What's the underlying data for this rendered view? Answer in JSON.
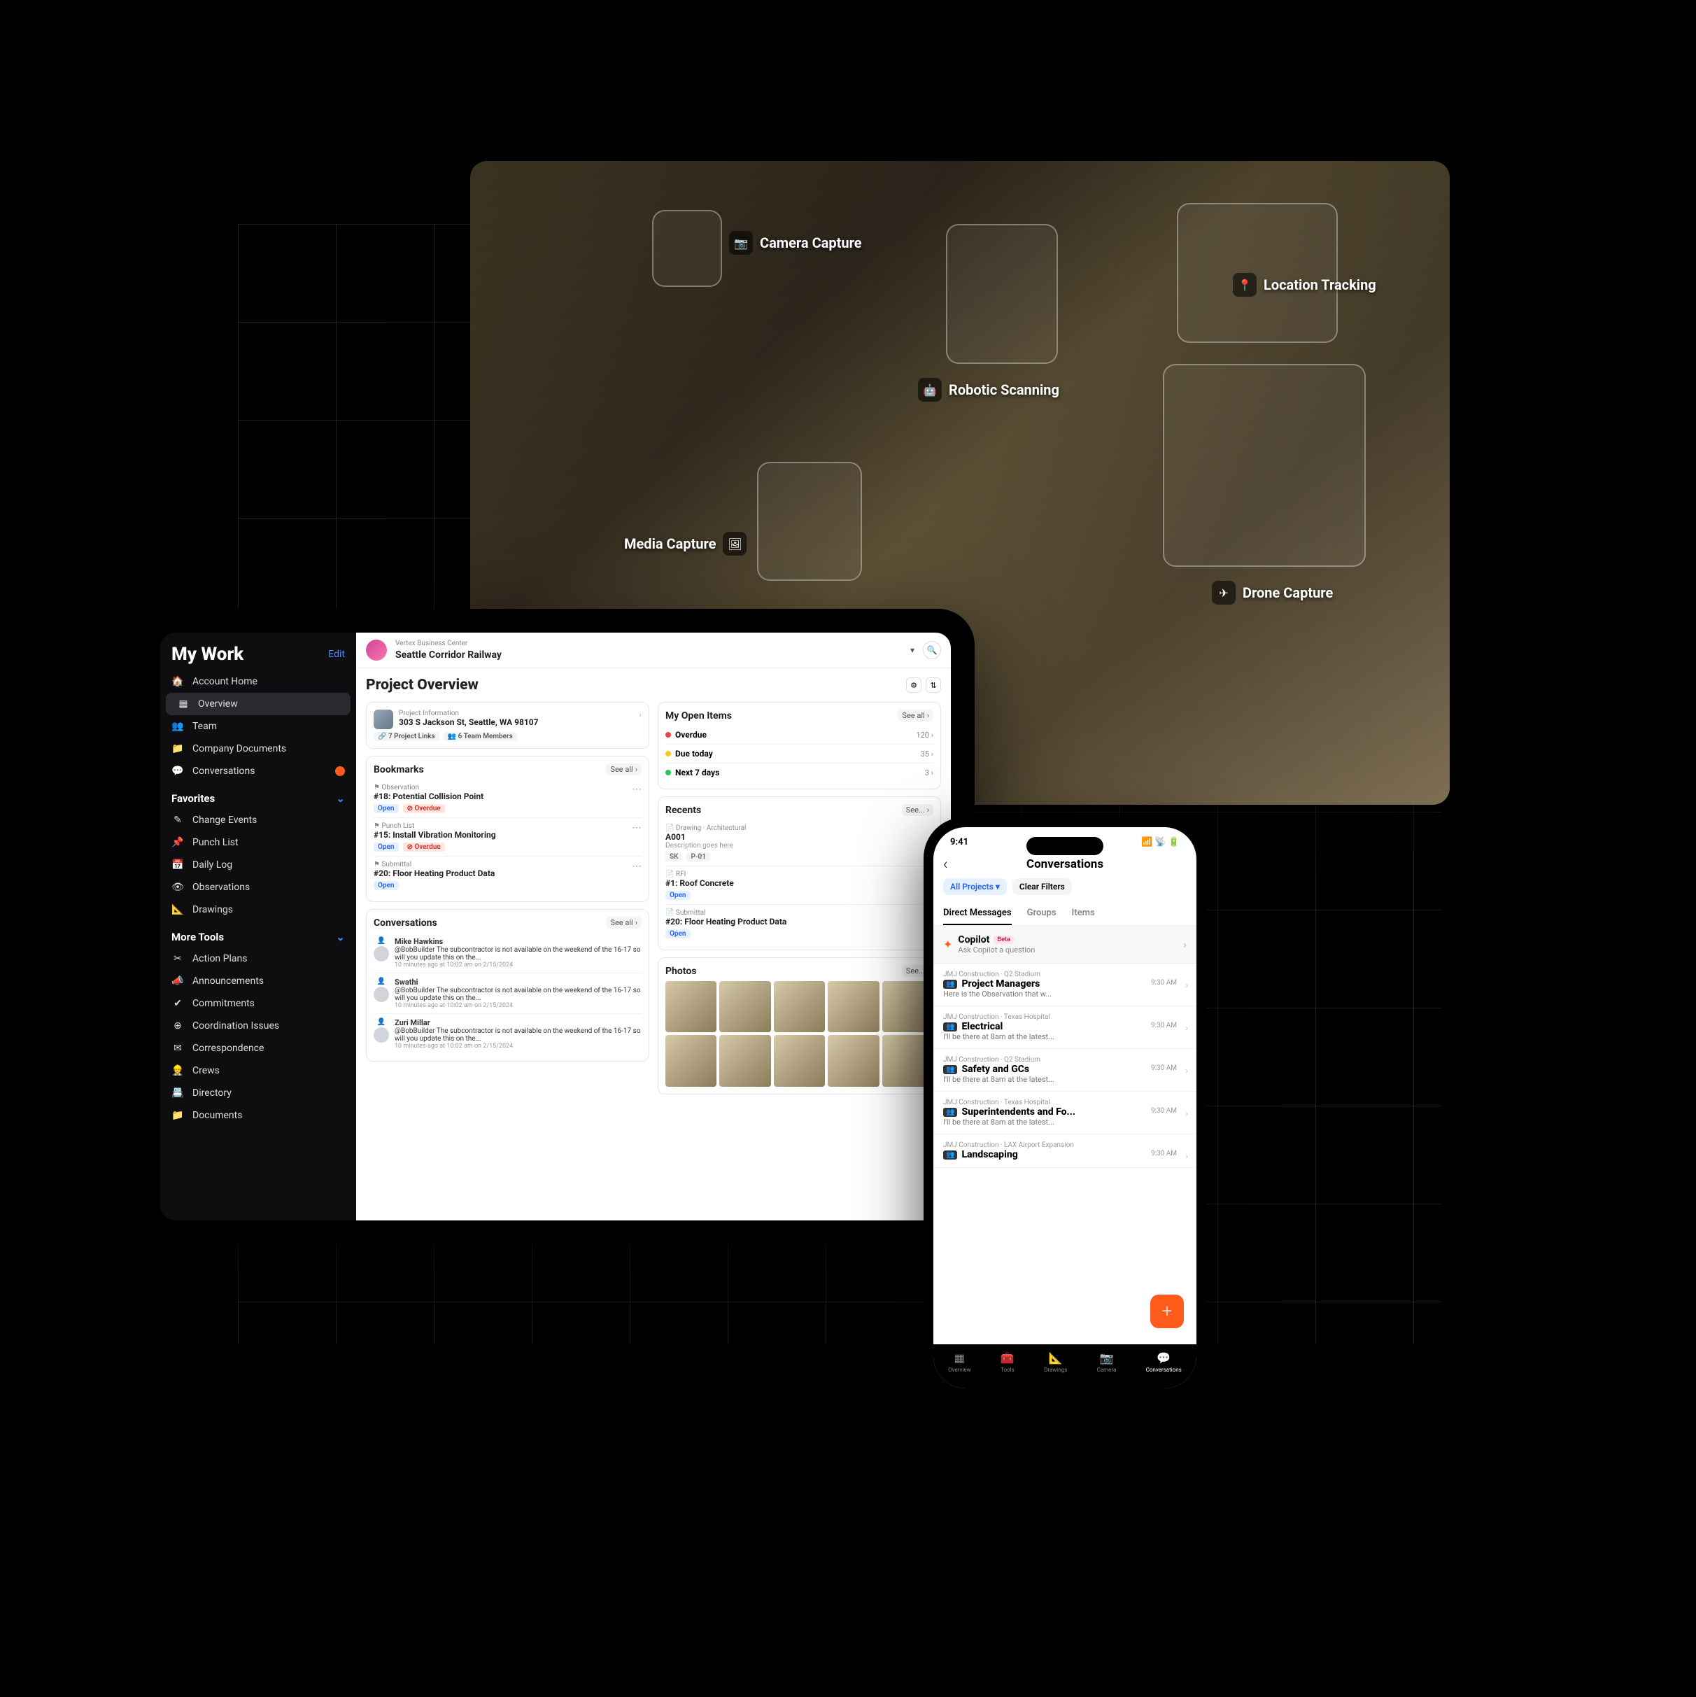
{
  "hero": {
    "annotations": [
      {
        "label": "Camera Capture",
        "icon": "📷"
      },
      {
        "label": "Robotic Scanning",
        "icon": "🤖"
      },
      {
        "label": "Media Capture",
        "icon": "🖼"
      },
      {
        "label": "Location Tracking",
        "icon": "📍"
      },
      {
        "label": "Drone Capture",
        "icon": "✈"
      }
    ]
  },
  "tablet": {
    "sidebar": {
      "title": "My Work",
      "edit": "Edit",
      "nav_top": [
        {
          "label": "Account Home",
          "icon": "🏠"
        },
        {
          "label": "Overview",
          "icon": "▦",
          "active": true
        },
        {
          "label": "Team",
          "icon": "👥"
        },
        {
          "label": "Company Documents",
          "icon": "📁"
        },
        {
          "label": "Conversations",
          "icon": "💬",
          "badge": true
        }
      ],
      "favorites_label": "Favorites",
      "favorites": [
        {
          "label": "Change Events",
          "icon": "✎"
        },
        {
          "label": "Punch List",
          "icon": "📌"
        },
        {
          "label": "Daily Log",
          "icon": "📅"
        },
        {
          "label": "Observations",
          "icon": "👁"
        },
        {
          "label": "Drawings",
          "icon": "📐"
        }
      ],
      "more_label": "More Tools",
      "more": [
        {
          "label": "Action Plans",
          "icon": "✂"
        },
        {
          "label": "Announcements",
          "icon": "📣"
        },
        {
          "label": "Commitments",
          "icon": "✔"
        },
        {
          "label": "Coordination Issues",
          "icon": "⊕"
        },
        {
          "label": "Correspondence",
          "icon": "✉"
        },
        {
          "label": "Crews",
          "icon": "👷"
        },
        {
          "label": "Directory",
          "icon": "📇"
        },
        {
          "label": "Documents",
          "icon": "📁"
        }
      ]
    },
    "header": {
      "company": "Vertex Business Center",
      "project": "Seattle Corridor Railway"
    },
    "page_title": "Project Overview",
    "project_info": {
      "label": "Project Information",
      "address": "303 S Jackson St, Seattle, WA 98107",
      "links": "7 Project Links",
      "team": "6 Team Members"
    },
    "bookmarks": {
      "title": "Bookmarks",
      "see_all": "See all",
      "items": [
        {
          "type": "Observation",
          "title": "#18: Potential Collision Point",
          "open": "Open",
          "overdue": "Overdue"
        },
        {
          "type": "Punch List",
          "title": "#15: Install Vibration Monitoring",
          "open": "Open",
          "overdue": "Overdue"
        },
        {
          "type": "Submittal",
          "title": "#20: Floor Heating Product Data",
          "open": "Open"
        }
      ]
    },
    "conversations": {
      "title": "Conversations",
      "see_all": "See all",
      "items": [
        {
          "author": "Mike Hawkins",
          "body": "@BobBuilder The subcontractor is not available on the weekend of the 16-17 so will you update this on the...",
          "time": "10 minutes ago at 10:02 am on 2/15/2024"
        },
        {
          "author": "Swathi",
          "body": "@BobBuilder The subcontractor is not available on the weekend of the 16-17 so will you update this on the...",
          "time": "10 minutes ago at 10:02 am on 2/15/2024"
        },
        {
          "author": "Zuri Millar",
          "body": "@BobBuilder The subcontractor is not available on the weekend of the 16-17 so will you update this on the...",
          "time": "10 minutes ago at 10:02 am on 2/15/2024"
        }
      ]
    },
    "open_items": {
      "title": "My Open Items",
      "see_all": "See all",
      "rows": [
        {
          "label": "Overdue",
          "count": 120,
          "color": "red"
        },
        {
          "label": "Due today",
          "count": 35,
          "color": "yellow"
        },
        {
          "label": "Next 7 days",
          "count": 3,
          "color": "green"
        }
      ]
    },
    "recents": {
      "title": "Recents",
      "see_all": "See...",
      "items": [
        {
          "type": "Drawing · Architectural",
          "title": "A001",
          "desc": "Description goes here",
          "chips": [
            "SK",
            "P-01"
          ]
        },
        {
          "type": "RFI",
          "title": "#1: Roof Concrete",
          "open": "Open"
        },
        {
          "type": "Submittal",
          "title": "#20: Floor Heating Product Data",
          "open": "Open"
        }
      ]
    },
    "photos": {
      "title": "Photos",
      "see_all": "See..."
    }
  },
  "phone": {
    "time": "9:41",
    "title": "Conversations",
    "chips": {
      "all": "All Projects",
      "clear": "Clear Filters"
    },
    "tabs": [
      "Direct Messages",
      "Groups",
      "Items"
    ],
    "copilot": {
      "name": "Copilot",
      "badge": "Beta",
      "sub": "Ask Copilot a question"
    },
    "dms": [
      {
        "proj": "JMJ Construction · Q2 Stadium",
        "name": "Project Managers",
        "preview": "Here is the Observation that w...",
        "time": "9:30 AM"
      },
      {
        "proj": "JMJ Construction · Texas Hospital",
        "name": "Electrical",
        "preview": "I'll be there at 8am at the latest...",
        "time": "9:30 AM"
      },
      {
        "proj": "JMJ Construction · Q2 Stadium",
        "name": "Safety and GCs",
        "preview": "I'll be there at 8am at the latest...",
        "time": "9:30 AM"
      },
      {
        "proj": "JMJ Construction · Texas Hospital",
        "name": "Superintendents and Fo...",
        "preview": "I'll be there at 8am at the latest...",
        "time": "9:30 AM"
      },
      {
        "proj": "JMJ Construction · LAX Airport Expansion",
        "name": "Landscaping",
        "preview": "",
        "time": "9:30 AM"
      }
    ],
    "bottom": [
      {
        "label": "Overview",
        "icon": "▦"
      },
      {
        "label": "Tools",
        "icon": "🧰"
      },
      {
        "label": "Drawings",
        "icon": "📐"
      },
      {
        "label": "Camera",
        "icon": "📷"
      },
      {
        "label": "Conversations",
        "icon": "💬",
        "active": true
      }
    ]
  }
}
